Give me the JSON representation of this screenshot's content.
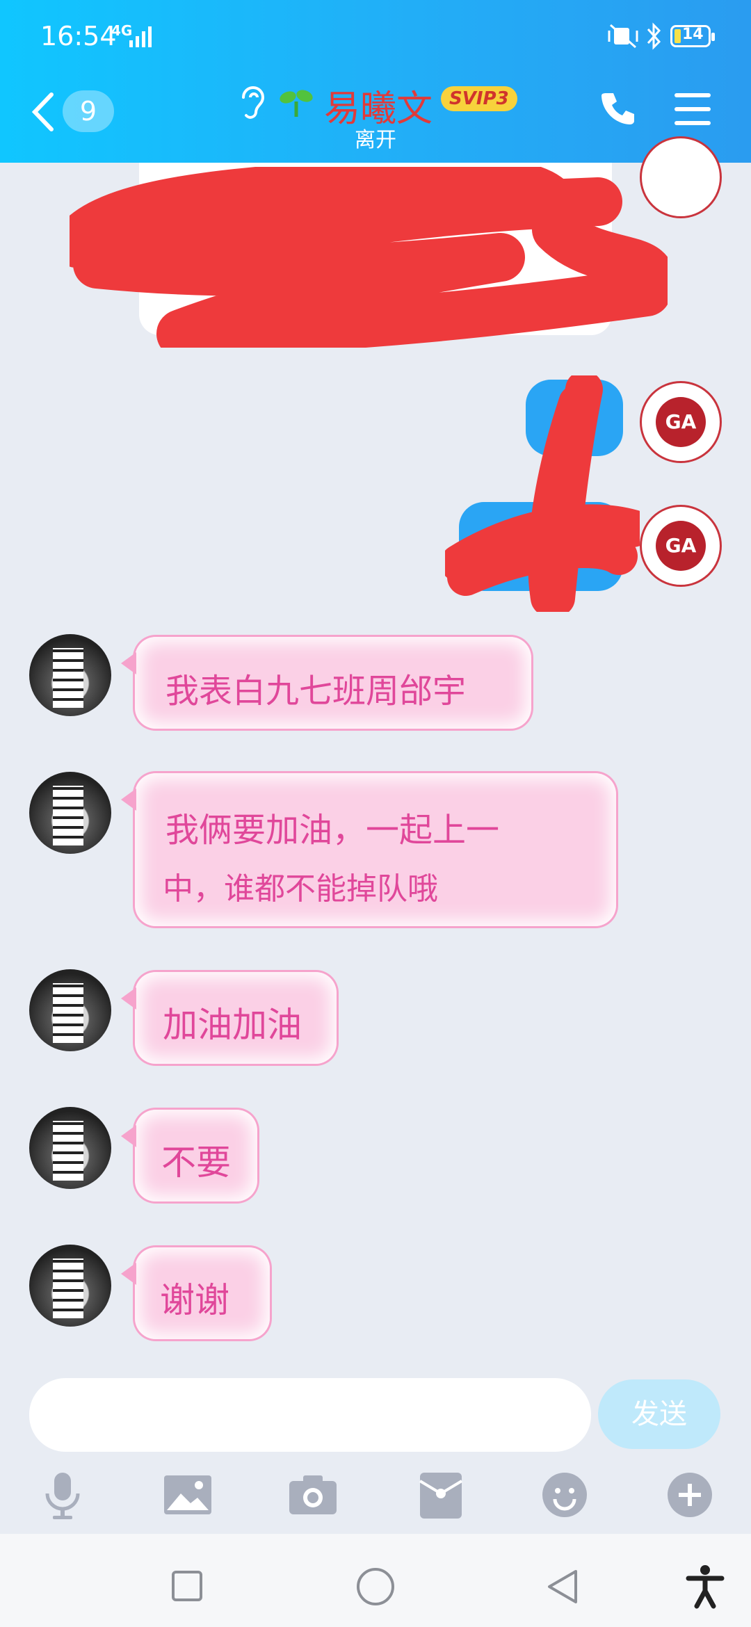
{
  "status_bar": {
    "time": "16:54",
    "network": "4G",
    "battery": "14"
  },
  "header": {
    "unread_count": "9",
    "contact_name": "易曦文",
    "badge": "SVIP3",
    "status": "离开"
  },
  "messages": [
    {
      "from": "contact",
      "text": "我表白九七班周邰宇"
    },
    {
      "from": "contact",
      "line1": "我俩要加油，一起上一",
      "line2": "中，谁都不能掉队哦"
    },
    {
      "from": "contact",
      "text": "加油加油"
    },
    {
      "from": "contact",
      "text": "不要"
    },
    {
      "from": "contact",
      "text": "谢谢"
    }
  ],
  "input": {
    "placeholder": "",
    "send_label": "发送"
  },
  "toolbar": [
    "microphone-icon",
    "image-icon",
    "camera-icon",
    "red-packet-icon",
    "emoji-icon",
    "plus-icon"
  ],
  "navbar": [
    "recent-apps-icon",
    "home-icon",
    "back-icon",
    "accessibility-icon"
  ],
  "colors": {
    "header": "#22aef7",
    "bubble": "#fbd0e6",
    "bubble_text": "#e0479a",
    "name": "#e03a3a"
  }
}
